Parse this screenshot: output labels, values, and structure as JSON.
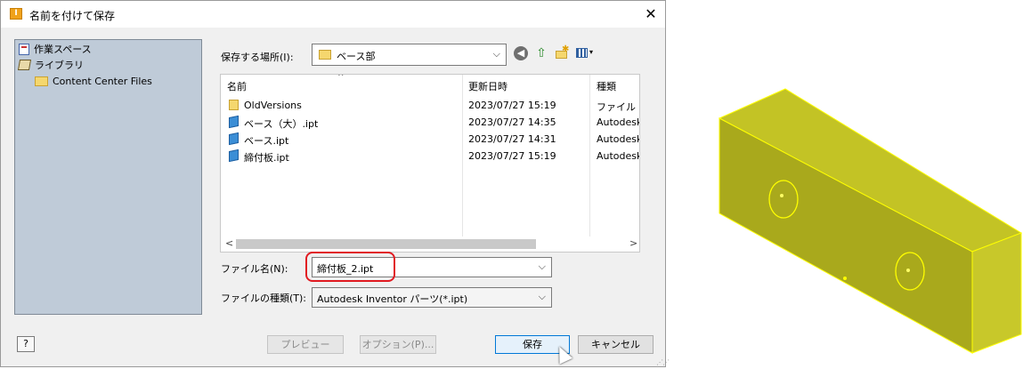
{
  "dialog": {
    "title": "名前を付けて保存",
    "app_icon_glyph": "I",
    "close_glyph": "✕"
  },
  "places": {
    "items": [
      {
        "label": "作業スペース",
        "icon": "workspace-icon"
      },
      {
        "label": "ライブラリ",
        "icon": "library-icon"
      },
      {
        "label": "Content Center Files",
        "icon": "folder-icon"
      }
    ]
  },
  "location": {
    "label": "保存する場所(I):",
    "value": "ベース部"
  },
  "toolbar": {
    "back_glyph": "◀",
    "up_glyph": "⇧",
    "new_folder_glyph": "✱",
    "view_menu_glyph": "▾"
  },
  "filelist": {
    "columns": [
      "名前",
      "更新日時",
      "種類"
    ],
    "sort_glyph": "^",
    "rows": [
      {
        "name": "OldVersions",
        "date": "2023/07/27 15:19",
        "type": "ファイル フォ",
        "icon": "folder"
      },
      {
        "name": "ベース（大）.ipt",
        "date": "2023/07/27 14:35",
        "type": "Autodesk",
        "icon": "part"
      },
      {
        "name": "ベース.ipt",
        "date": "2023/07/27 14:31",
        "type": "Autodesk",
        "icon": "part"
      },
      {
        "name": "締付板.ipt",
        "date": "2023/07/27 15:19",
        "type": "Autodesk",
        "icon": "part"
      }
    ],
    "scroll_left": "<",
    "scroll_right": ">"
  },
  "filename": {
    "label": "ファイル名(N):",
    "value": "締付板_2.ipt"
  },
  "filetype": {
    "label": "ファイルの種類(T):",
    "value": "Autodesk Inventor パーツ(*.ipt)"
  },
  "buttons": {
    "help": "?",
    "preview": "プレビュー",
    "options": "オプション(P)...",
    "save": "保存",
    "cancel": "キャンセル"
  },
  "colors": {
    "part_body": "#b5b521",
    "part_edge": "#ffff00",
    "highlight": "#e11b22"
  }
}
